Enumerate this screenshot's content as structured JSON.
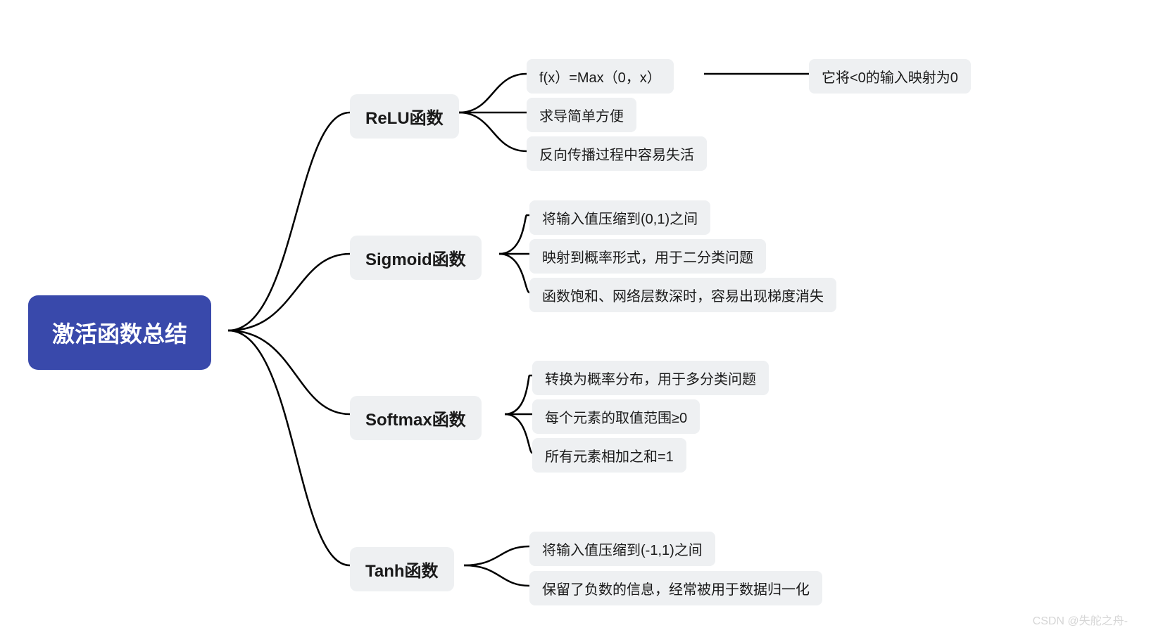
{
  "root": {
    "title": "激活函数总结"
  },
  "branches": [
    {
      "label": "ReLU函数",
      "children": [
        {
          "text": "f(x）=Max（0，x）",
          "extra": "它将<0的输入映射为0"
        },
        {
          "text": "求导简单方便"
        },
        {
          "text": "反向传播过程中容易失活"
        }
      ]
    },
    {
      "label": "Sigmoid函数",
      "children": [
        {
          "text": "将输入值压缩到(0,1)之间"
        },
        {
          "text": "映射到概率形式，用于二分类问题"
        },
        {
          "text": "函数饱和、网络层数深时，容易出现梯度消失"
        }
      ]
    },
    {
      "label": "Softmax函数",
      "children": [
        {
          "text": "转换为概率分布，用于多分类问题"
        },
        {
          "text": "每个元素的取值范围≥0"
        },
        {
          "text": "所有元素相加之和=1"
        }
      ]
    },
    {
      "label": "Tanh函数",
      "children": [
        {
          "text": "将输入值压缩到(-1,1)之间"
        },
        {
          "text": "保留了负数的信息，经常被用于数据归一化"
        }
      ]
    }
  ],
  "watermark": "CSDN @失舵之舟-",
  "colors": {
    "root_bg": "#3949ab",
    "node_bg": "#eef0f2",
    "line": "#000000"
  }
}
